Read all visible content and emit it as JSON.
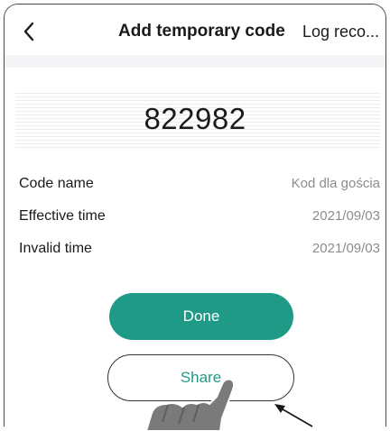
{
  "header": {
    "back_icon": "chevron-left-icon",
    "title": "Add temporary code",
    "right_action": "Log reco..."
  },
  "code": {
    "value": "822982"
  },
  "details": [
    {
      "label": "Code name",
      "value": "Kod dla gościa"
    },
    {
      "label": "Effective time",
      "value": "2021/09/03"
    },
    {
      "label": "Invalid time",
      "value": "2021/09/03"
    }
  ],
  "actions": {
    "done_label": "Done",
    "share_label": "Share"
  },
  "colors": {
    "accent": "#1f9a86",
    "value_text": "#8c8c8c"
  },
  "annotations": {
    "hand_icon": "pointing-hand-icon",
    "arrow_icon": "arrow-icon"
  }
}
